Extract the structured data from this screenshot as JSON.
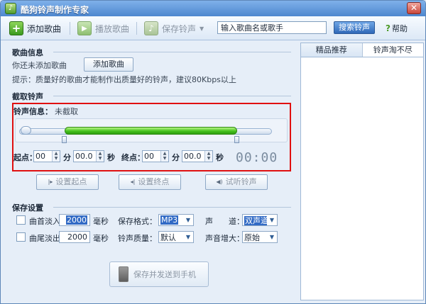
{
  "window": {
    "title": "酷狗铃声制作专家",
    "close_label": "✕"
  },
  "toolbar": {
    "add_song": "添加歌曲",
    "play_song": "播放歌曲",
    "save_ringtone": "保存铃声",
    "search_placeholder": "输入歌曲名或歌手",
    "search_button": "搜索铃声",
    "help": "帮助"
  },
  "song_info": {
    "header": "歌曲信息",
    "status": "你还未添加歌曲",
    "add_button": "添加歌曲",
    "tip": "提示：质量好的歌曲才能制作出质量好的铃声，建议80Kbps以上"
  },
  "cut": {
    "header": "截取铃声",
    "info_label": "铃声信息：",
    "info_value": "未截取",
    "start_label": "起点：",
    "end_label": "终点：",
    "minute_unit": "分",
    "second_unit": "秒",
    "start_min": "00",
    "start_sec": "00.0",
    "end_min": "00",
    "end_sec": "00.0",
    "time_display": "00:00",
    "set_start": "设置起点",
    "set_end": "设置终点",
    "preview": "试听铃声"
  },
  "save": {
    "header": "保存设置",
    "fade_in_label": "曲首淡入",
    "fade_in_value": "2000",
    "fade_out_label": "曲尾淡出",
    "fade_out_value": "2000",
    "ms_unit": "毫秒",
    "format_label": "保存格式：",
    "format_value": "MP3",
    "quality_label": "铃声质量：",
    "quality_value": "默认",
    "channel_label": "声　　道：",
    "channel_value": "双声道",
    "boost_label": "声音增大：",
    "boost_value": "原始",
    "export_button": "保存并发送到手机"
  },
  "right_tabs": [
    "精品推荐",
    "铃声淘不尽"
  ],
  "colors": {
    "accent": "#2f68b8",
    "highlight_box": "#e01010",
    "slider_fill": "#45c21d"
  }
}
